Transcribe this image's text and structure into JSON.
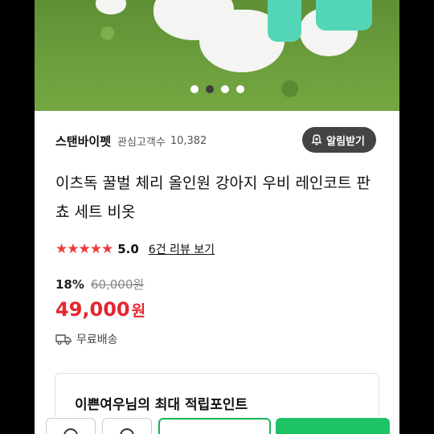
{
  "product_image": {
    "carousel_count": 4,
    "carousel_active_index": 1
  },
  "seller": {
    "name": "스탠바이펫",
    "followers_label": "관심고객수",
    "followers_count": "10,382",
    "alert_button": "알림받기"
  },
  "product": {
    "title": "이츠독 꿀벌 체리 올인원 강아지 우비 레인코트 판쵸 세트 비옷",
    "stars": "★★★★★",
    "rating": "5.0",
    "review_link": "6건 리뷰 보기",
    "discount_percent": "18%",
    "original_price": "60,000원",
    "price": "49,000",
    "price_unit": "원",
    "shipping": "무료배송"
  },
  "promo": {
    "text": "이쁜여우님의 최대 적립포인트"
  },
  "colors": {
    "accent_red": "#e4262e",
    "star_red": "#ec3a3a",
    "buy_green": "#1ec463",
    "alert_button_bg": "#444444"
  },
  "icons": {
    "bell": "bell-plus-icon",
    "truck": "delivery-truck-icon",
    "heart": "heart-icon",
    "chat": "chat-icon"
  }
}
